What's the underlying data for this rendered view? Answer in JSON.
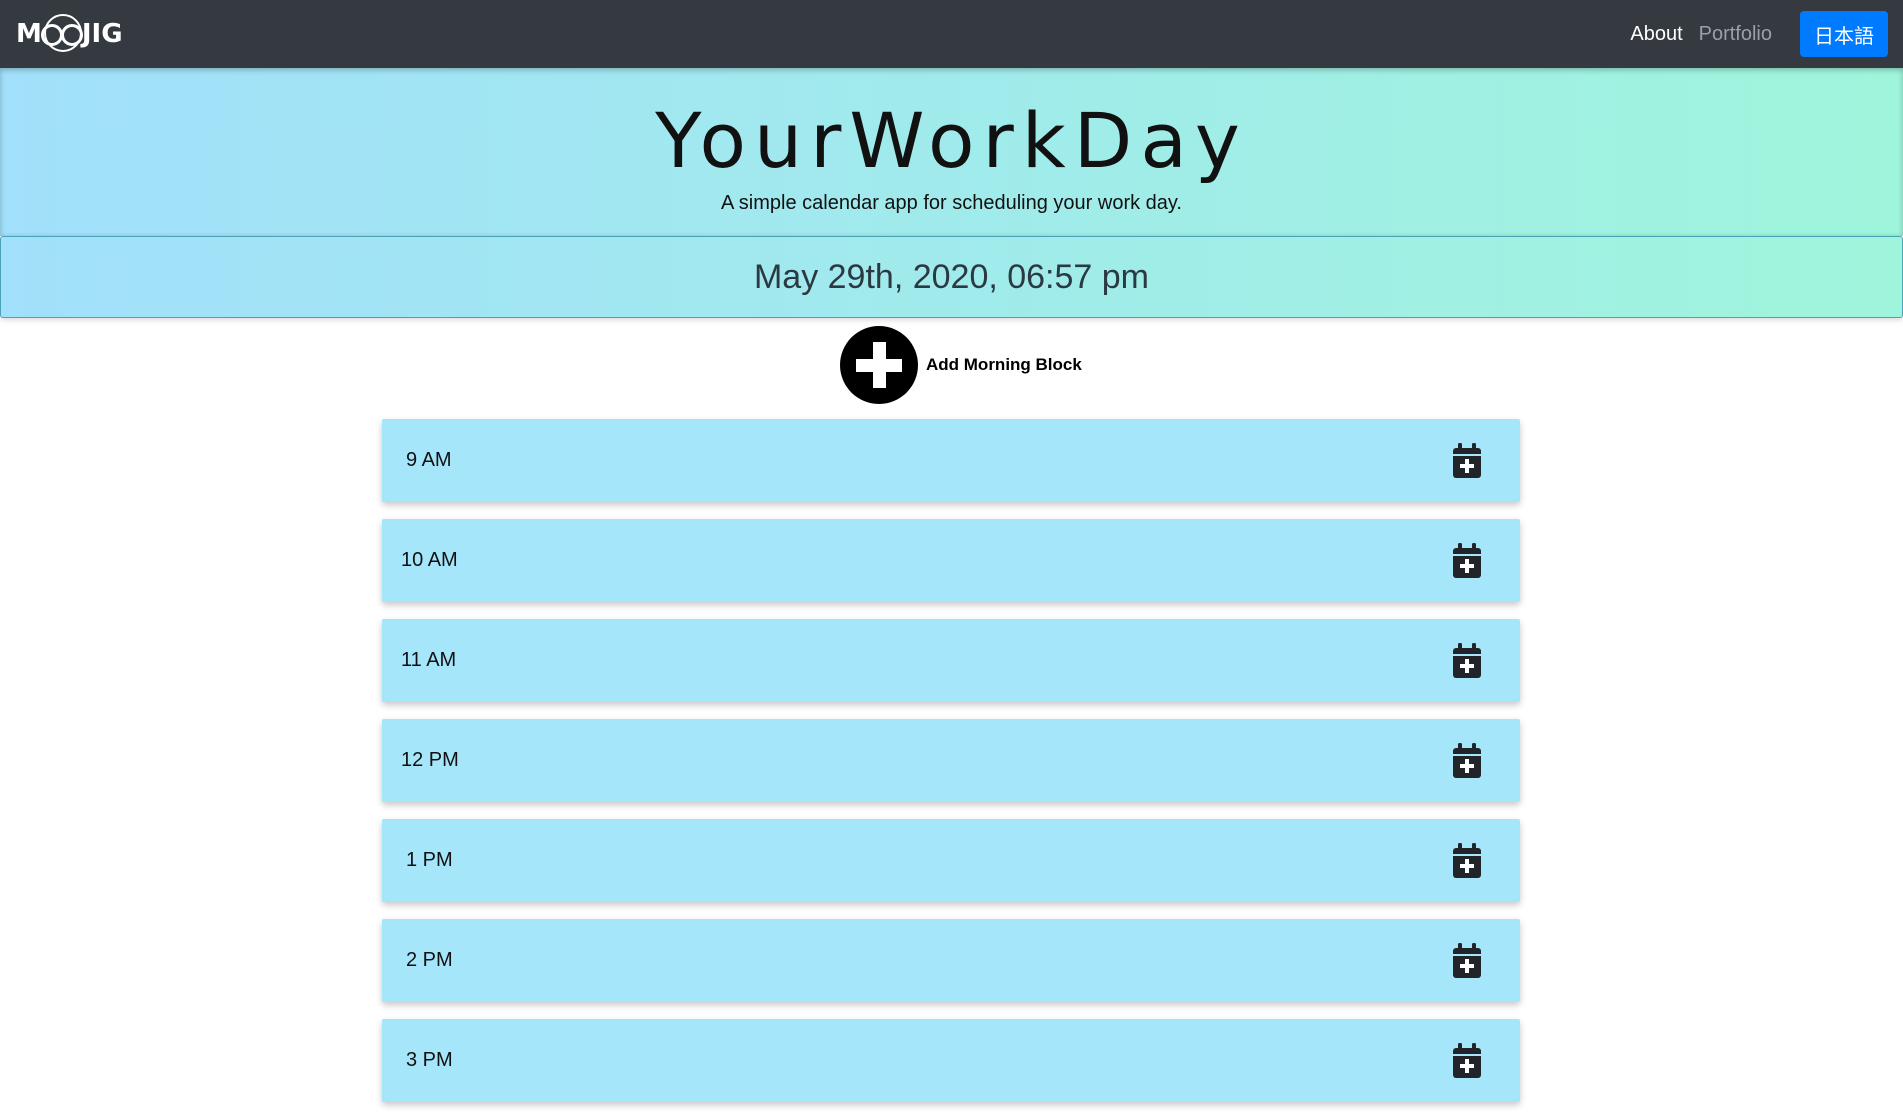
{
  "navbar": {
    "brand_prefix": "M",
    "brand_suffix": "JIG",
    "links": [
      {
        "label": "About"
      },
      {
        "label": "Portfolio"
      }
    ],
    "language_button": "日本語"
  },
  "header": {
    "title": "YourWorkDay",
    "subtitle": "A simple calendar app for scheduling your work day."
  },
  "current_datetime": "May 29th, 2020, 06:57 pm",
  "add_morning_block": {
    "label": "Add Morning Block",
    "icon": "plus-circle-icon"
  },
  "time_blocks": [
    {
      "hour": "9 AM"
    },
    {
      "hour": "10 AM"
    },
    {
      "hour": "11 AM"
    },
    {
      "hour": "12 PM"
    },
    {
      "hour": "1 PM"
    },
    {
      "hour": "2 PM"
    },
    {
      "hour": "3 PM"
    }
  ],
  "colors": {
    "navbar_bg": "#343a40",
    "language_button_bg": "#007bff",
    "gradient_start": "#a2e0fb",
    "gradient_end": "#9ff5dc",
    "time_block_bg": "#a5e6fb"
  },
  "icons": {
    "block_action": "calendar-plus-icon"
  }
}
